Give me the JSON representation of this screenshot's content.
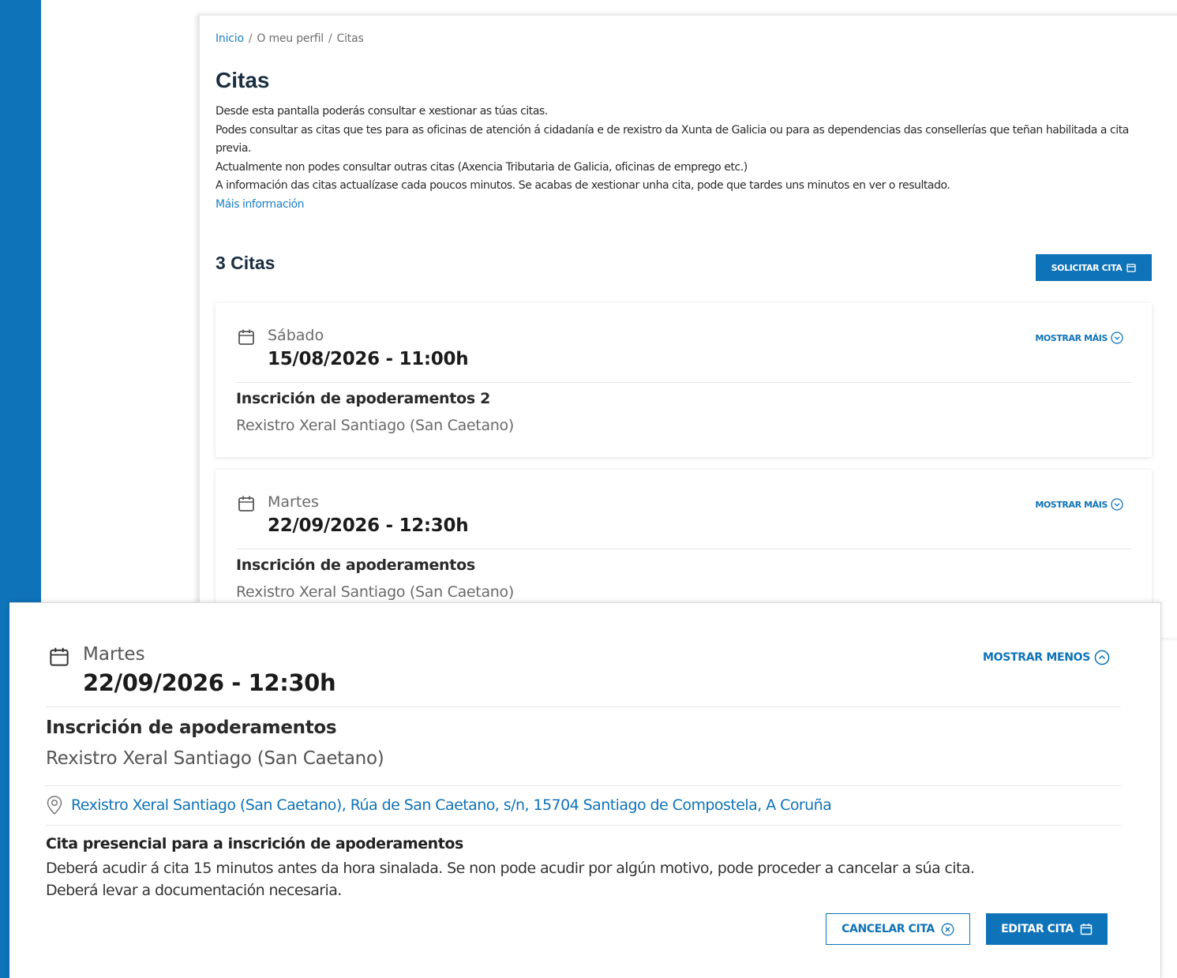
{
  "colors": {
    "brand_blue": "#0f73b9",
    "link_blue": "#1a7fc9",
    "heading": "#1b2f40"
  },
  "breadcrumb": {
    "home": "Inicio",
    "profile": "O meu perfil",
    "current": "Citas",
    "separator": "/"
  },
  "page": {
    "title": "Citas",
    "intro_lines": [
      "Desde esta pantalla poderás consultar e xestionar as túas citas.",
      "Podes consultar as citas que tes para as oficinas de atención á cidadanía e de rexistro da Xunta de Galicia ou para as dependencias das consellerías que teñan habilitada a cita previa.",
      "Actualmente non podes consultar outras citas (Axencia Tributaria de Galicia, oficinas de emprego etc.)",
      "A información das citas actualízase cada poucos minutos. Se acabas de xestionar unha cita, pode que tardes uns minutos en ver o resultado."
    ],
    "more_info": "Máis información",
    "count_heading": "3 Citas",
    "request_button": "SOLICITAR CITA"
  },
  "appointments": [
    {
      "day": "Sábado",
      "datetime": "15/08/2026 - 11:00h",
      "service": "Inscrición de apoderamentos 2",
      "office": "Rexistro Xeral Santiago (San Caetano)",
      "toggle": "MOSTRAR MÁIS"
    },
    {
      "day": "Martes",
      "datetime": "22/09/2026 - 12:30h",
      "service": "Inscrición de apoderamentos",
      "office": "Rexistro Xeral Santiago (San Caetano)",
      "toggle": "MOSTRAR MÁIS"
    }
  ],
  "expanded": {
    "day": "Martes",
    "datetime": "22/09/2026 - 12:30h",
    "toggle": "MOSTRAR MENOS",
    "service": "Inscrición de apoderamentos",
    "office": "Rexistro Xeral Santiago (San Caetano)",
    "address": "Rexistro Xeral Santiago (San Caetano), Rúa de San Caetano, s/n, 15704 Santiago de Compostela, A Coruña",
    "note_title": "Cita presencial para a inscrición de apoderamentos",
    "note_lines": [
      "Deberá acudir á cita 15 minutos antes da hora sinalada. Se non pode acudir por algún motivo, pode proceder a cancelar a súa cita.",
      "Deberá levar a documentación necesaria."
    ],
    "cancel_button": "CANCELAR CITA",
    "edit_button": "EDITAR CITA"
  },
  "icons": {
    "calendar": "calendar-icon",
    "chevron_down": "chevron-down-circle-icon",
    "chevron_up": "chevron-up-circle-icon",
    "location": "location-pin-icon",
    "close": "close-circle-icon"
  }
}
